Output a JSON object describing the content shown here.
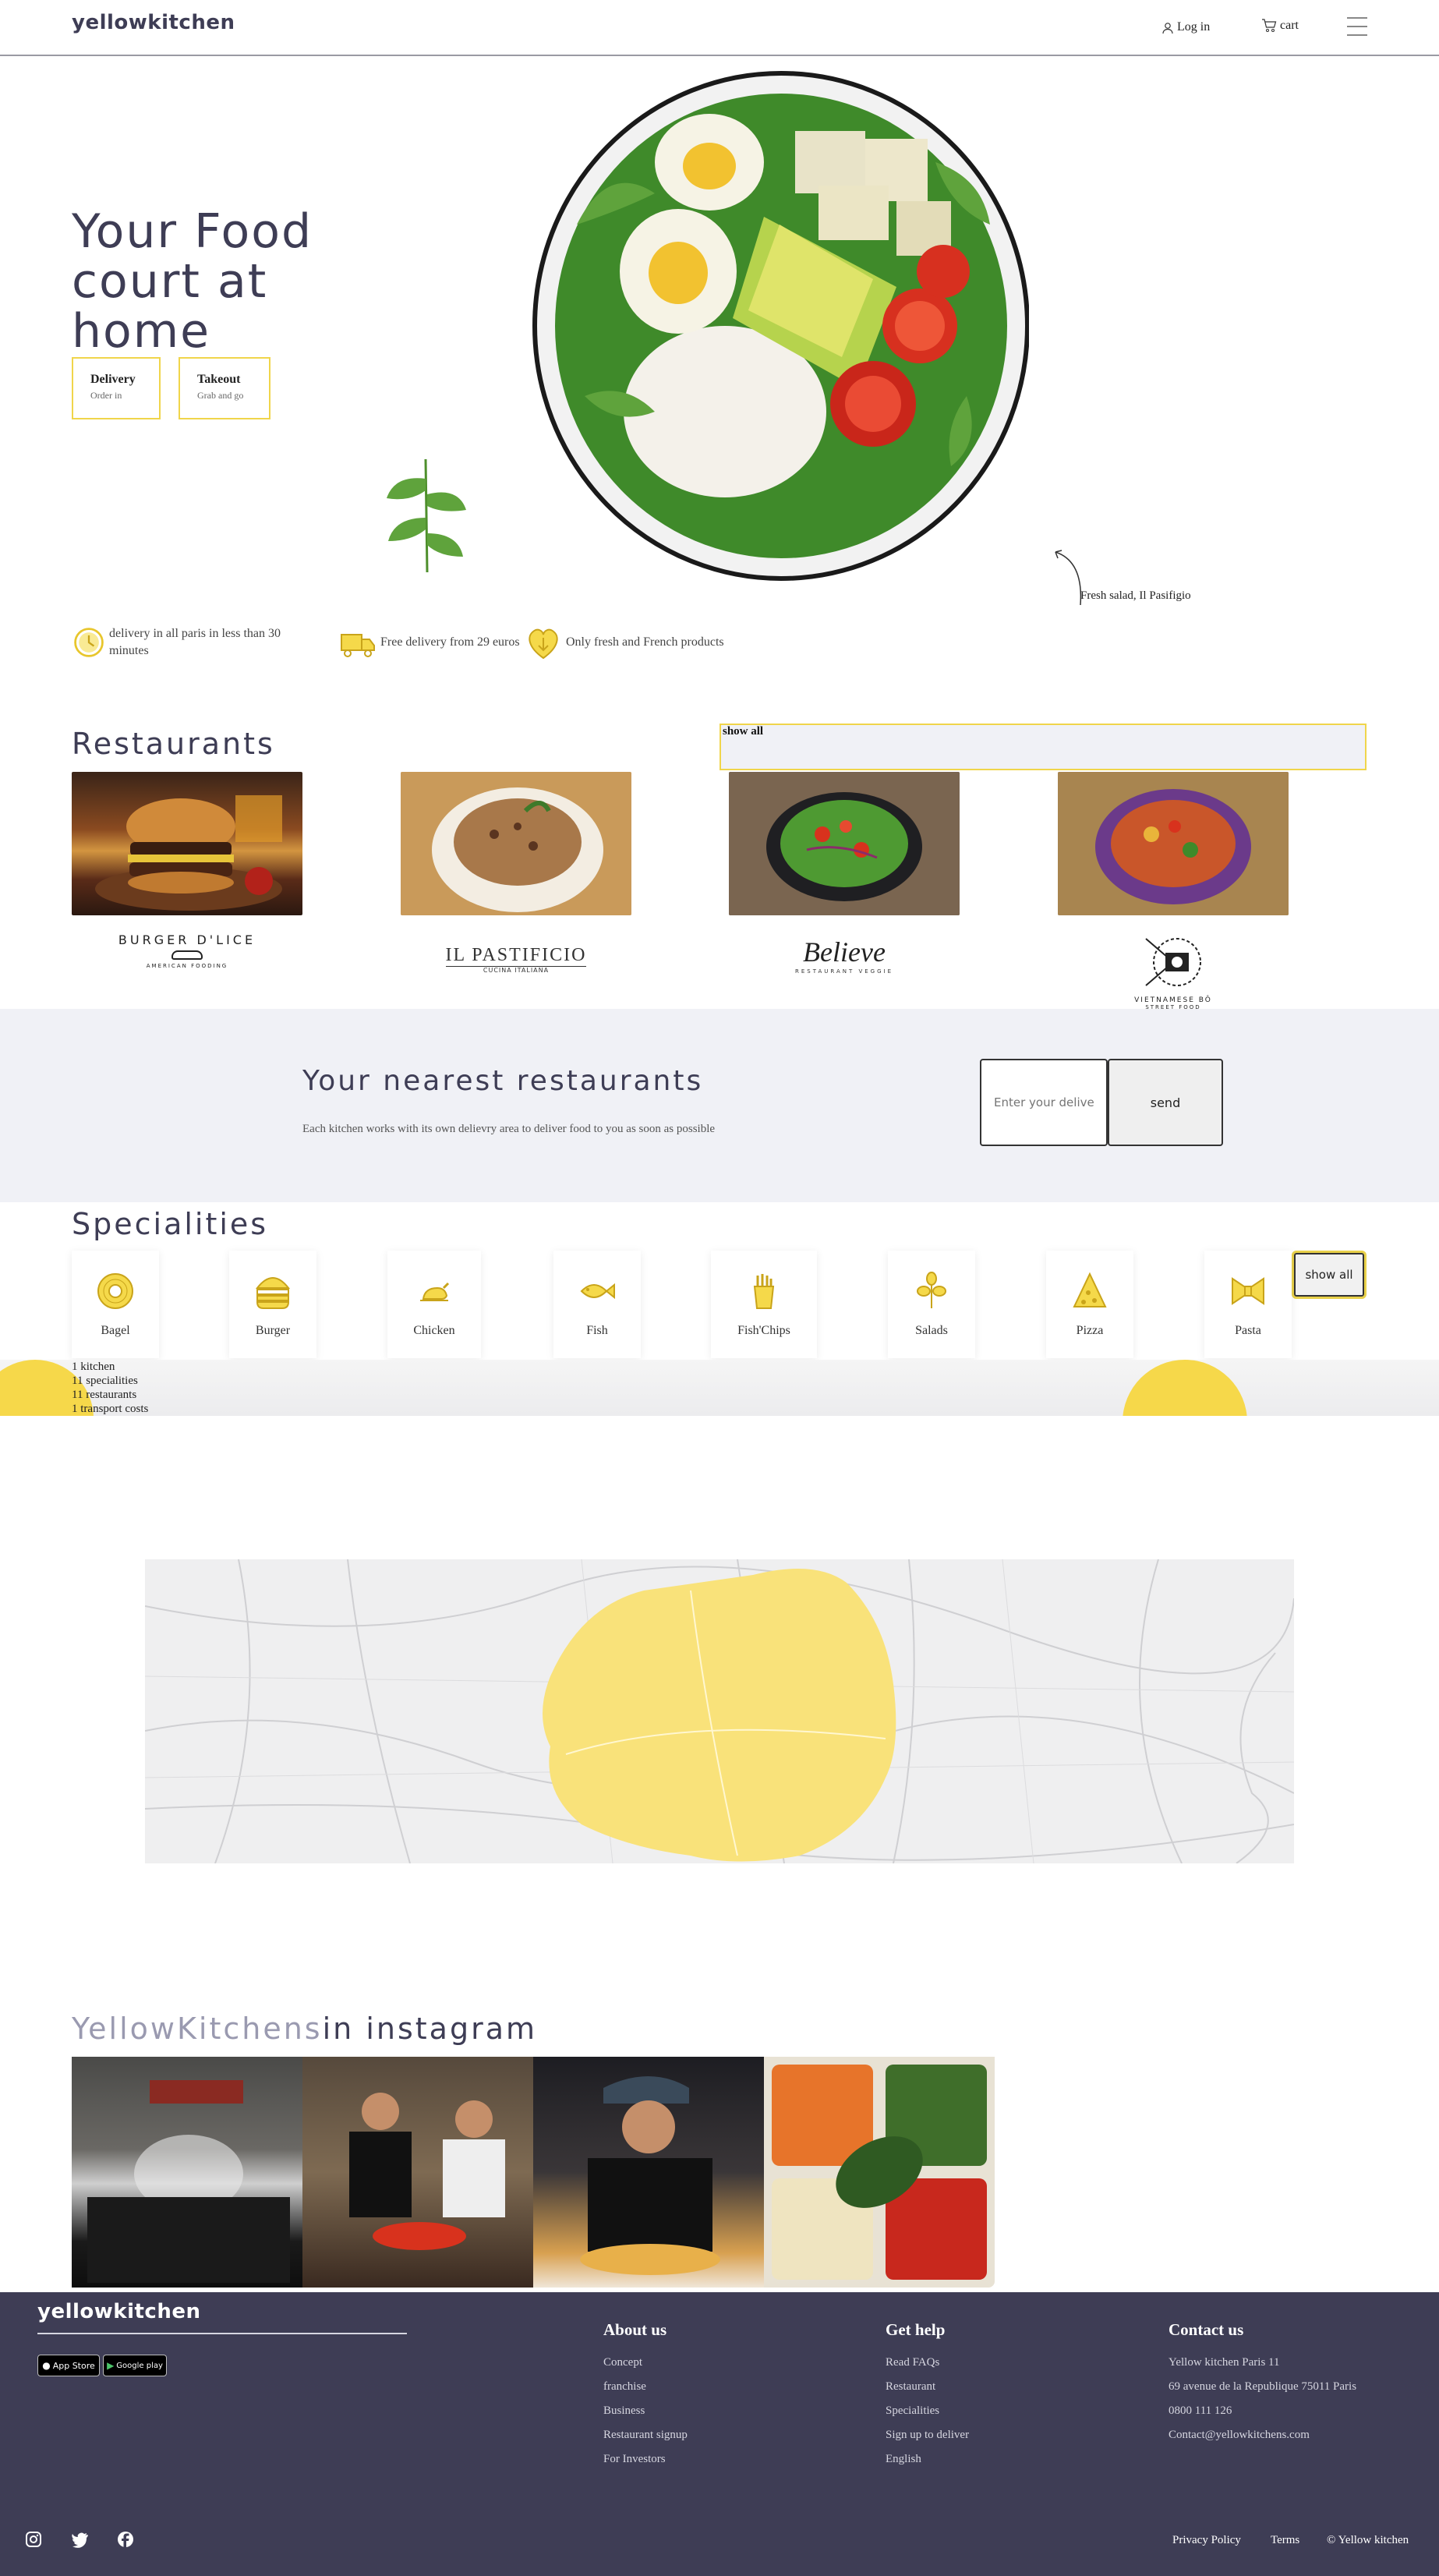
{
  "header": {
    "logo_yellow": "yellow",
    "logo_rest": "kitchen",
    "login": "Log in",
    "cart": "cart"
  },
  "hero": {
    "title": "Your Food court at home",
    "delivery_title": "Delivery",
    "delivery_sub": "Order in",
    "takeout_title": "Takeout",
    "takeout_sub": "Grab and go",
    "caption": "Fresh salad, Il Pasifigio"
  },
  "features": [
    {
      "text": "delivery in all paris in less than 30 minutes",
      "icon": "clock-icon"
    },
    {
      "text": "Free delivery from 29 euros",
      "icon": "delivery-truck-icon"
    },
    {
      "text": "Only fresh and French products",
      "icon": "heart-leaf-icon"
    }
  ],
  "restaurants": {
    "title": "Restaurants",
    "show_all": "show all",
    "items": [
      {
        "name": "BURGER D'LICE",
        "sub": "AMERICAN FOODING"
      },
      {
        "name": "IL PASTIFICIO",
        "sub": "CUCINA ITALIANA"
      },
      {
        "name": "Believe",
        "sub": "RESTAURANT VEGGIE"
      },
      {
        "name": "VIETNAMESE BÔ",
        "sub": "STREET FOOD"
      }
    ]
  },
  "nearest": {
    "title": "Your nearest restaurants",
    "desc": "Each kitchen works with its own delievry area to deliver food to you as soon as possible",
    "placeholder": "Enter your delivery",
    "send": "send"
  },
  "specialities": {
    "title": "Specialities",
    "show_all": "show all",
    "items": [
      {
        "label": "Bagel",
        "icon": "bagel-icon"
      },
      {
        "label": "Burger",
        "icon": "burger-icon"
      },
      {
        "label": "Chicken",
        "icon": "chicken-icon"
      },
      {
        "label": "Fish",
        "icon": "fish-icon"
      },
      {
        "label": "Fish'Chips",
        "icon": "fish-chips-icon"
      },
      {
        "label": "Salads",
        "icon": "salad-icon"
      },
      {
        "label": "Pizza",
        "icon": "pizza-icon"
      },
      {
        "label": "Pasta",
        "icon": "pasta-icon"
      }
    ]
  },
  "stats": [
    "1 kitchen",
    "11 specialities",
    "11 restaurants",
    "1 transport costs"
  ],
  "instagram": {
    "brand": "YellowKitchens",
    "rest": "in instagram"
  },
  "footer": {
    "about_title": "About us",
    "about_links": [
      "Concept",
      "franchise",
      "Business",
      "Restaurant signup",
      "For Investors"
    ],
    "help_title": "Get help",
    "help_links": [
      "Read FAQs",
      "Restaurant",
      "Specialities",
      "Sign up to deliver",
      "English"
    ],
    "contact_title": "Contact us",
    "contact_lines": [
      "Yellow kitchen Paris 11",
      "69 avenue de la Republique 75011 Paris",
      "0800 111 126",
      "Contact@yellowkitchens.com"
    ],
    "app_store": "App Store",
    "google_play": "Google play",
    "privacy": "Privacy Policy",
    "terms": "Terms",
    "copyright": "© Yellow kitchen"
  },
  "colors": {
    "accent": "#f5d94a",
    "footer_bg": "#3e3d55",
    "section_bg": "#f0f1f6"
  }
}
